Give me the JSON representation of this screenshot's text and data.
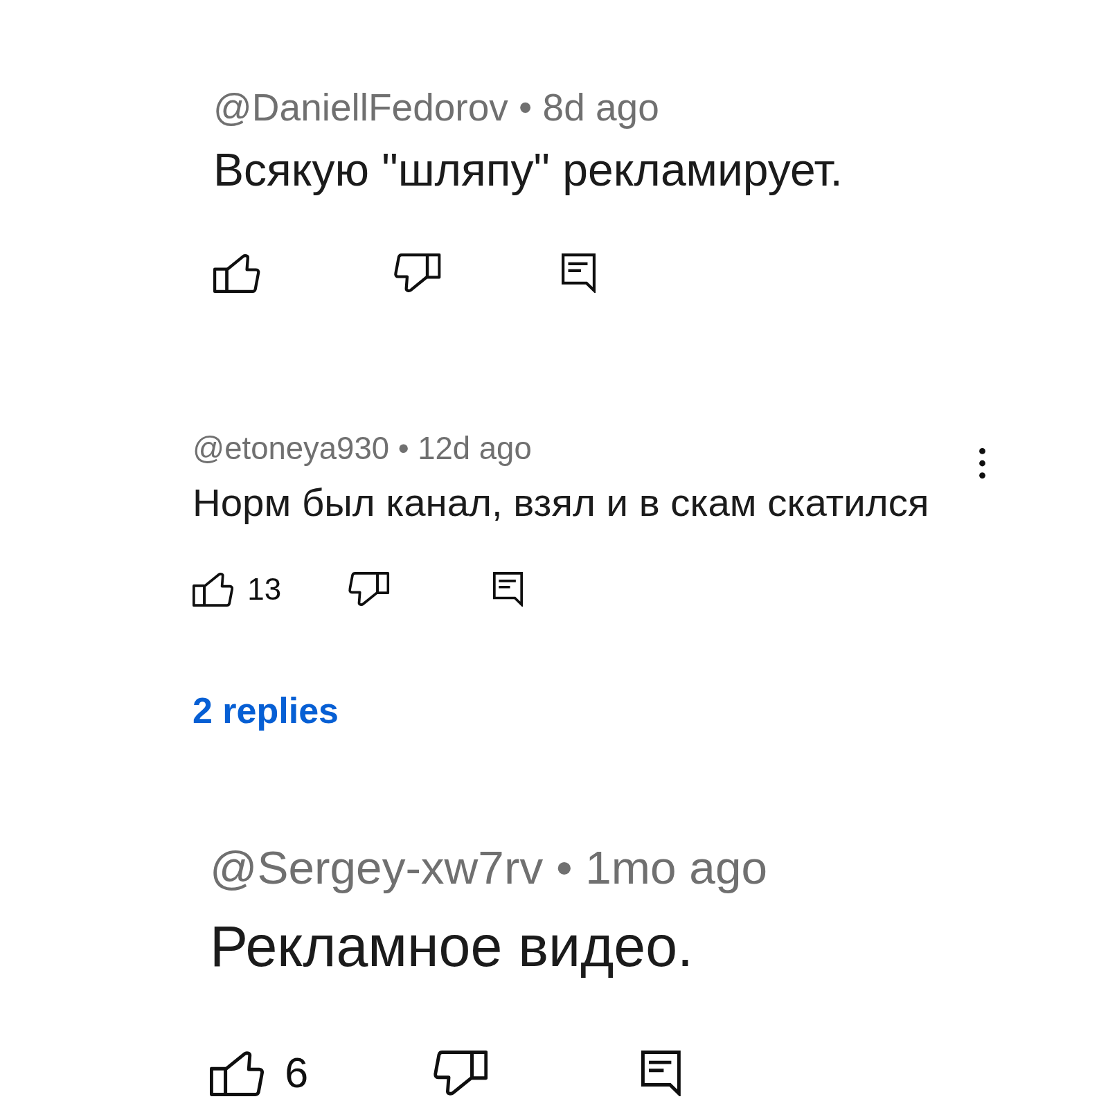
{
  "comments": [
    {
      "byline": "@DaniellFedorov • 8d ago",
      "text": "Всякую \"шляпу\" рекламирует.",
      "menu_button": false
    },
    {
      "byline": "@etoneya930 • 12d ago",
      "text": "Норм был канал, взял и в скам скатился",
      "menu_button": true,
      "likes": "13",
      "replies": "2 replies"
    },
    {
      "byline": "@Sergey-xw7rv • 1mo ago",
      "text": "Рекламное видео.",
      "menu_button": false,
      "likes": "6"
    }
  ]
}
